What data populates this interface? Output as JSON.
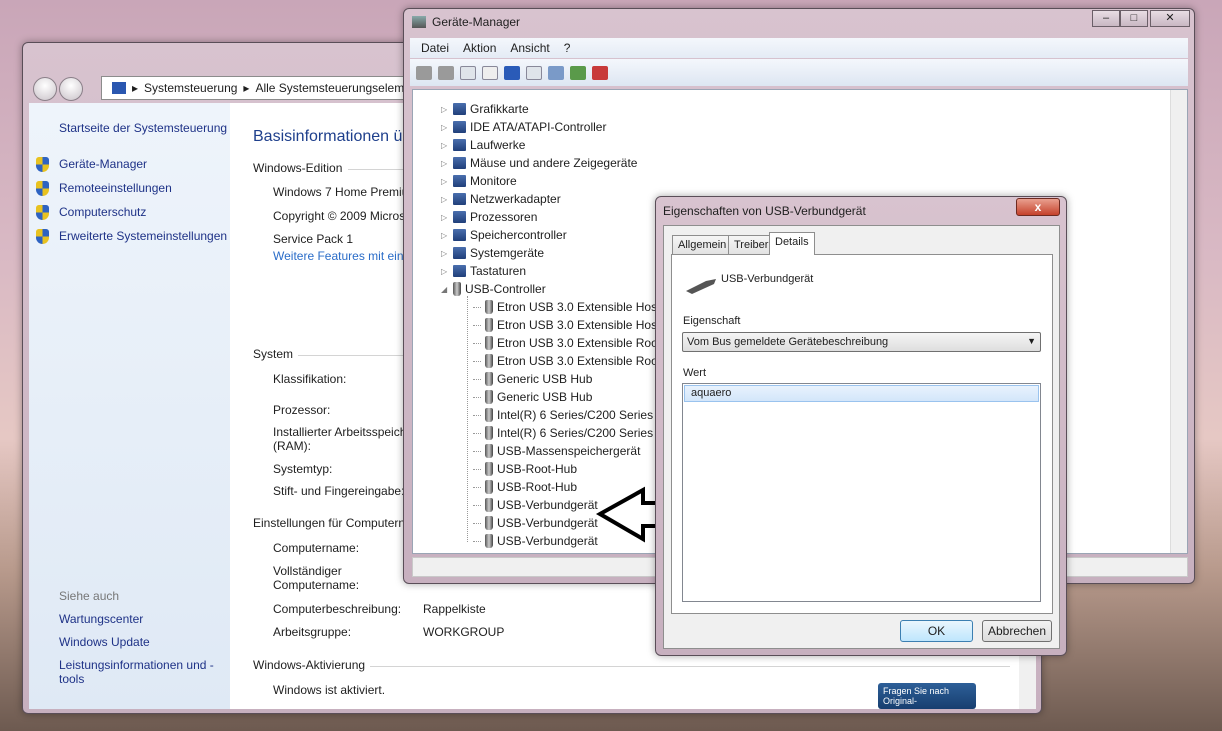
{
  "control_panel": {
    "breadcrumb": [
      "Systemsteuerung",
      "Alle Systemsteuerungseleme"
    ],
    "left": {
      "home": "Startseite der Systemsteuerung",
      "tasks": [
        "Geräte-Manager",
        "Remoteeinstellungen",
        "Computerschutz",
        "Erweiterte Systemeinstellungen"
      ],
      "see_also": "Siehe auch",
      "see_links": [
        "Wartungscenter",
        "Windows Update",
        "Leistungsinformationen und -tools"
      ]
    },
    "title": "Basisinformationen üb",
    "edition": {
      "heading": "Windows-Edition",
      "lines": [
        "Windows 7 Home Premiu",
        "Copyright © 2009 Micros",
        "Service Pack 1"
      ],
      "link": "Weitere Features mit eine"
    },
    "system": {
      "heading": "System",
      "labels": [
        "Klassifikation:",
        "Prozessor:",
        "Installierter Arbeitsspeich (RAM):",
        "Systemtyp:",
        "Stift- und Fingereingabe:"
      ]
    },
    "computer": {
      "heading": "Einstellungen für Computern",
      "labels": [
        "Computername:",
        "Vollständiger Computername:",
        "Computerbeschreibung:",
        "Arbeitsgruppe:"
      ],
      "description": "Rappelkiste",
      "workgroup": "WORKGROUP"
    },
    "activation": {
      "heading": "Windows-Aktivierung",
      "status": "Windows ist aktiviert.",
      "badge": "Fragen Sie nach Original-"
    }
  },
  "device_manager": {
    "title": "Geräte-Manager",
    "menu": [
      "Datei",
      "Aktion",
      "Ansicht",
      "?"
    ],
    "categories": [
      "Grafikkarte",
      "IDE ATA/ATAPI-Controller",
      "Laufwerke",
      "Mäuse und andere Zeigegeräte",
      "Monitore",
      "Netzwerkadapter",
      "Prozessoren",
      "Speichercontroller",
      "Systemgeräte",
      "Tastaturen",
      "USB-Controller"
    ],
    "usb_devices": [
      "Etron USB 3.0 Extensible Host C",
      "Etron USB 3.0 Extensible Host C",
      "Etron USB 3.0 Extensible Root H",
      "Etron USB 3.0 Extensible Root H",
      "Generic USB Hub",
      "Generic USB Hub",
      "Intel(R) 6 Series/C200 Series Ch",
      "Intel(R) 6 Series/C200 Series Ch",
      "USB-Massenspeichergerät",
      "USB-Root-Hub",
      "USB-Root-Hub",
      "USB-Verbundgerät",
      "USB-Verbundgerät",
      "USB-Verbundgerät"
    ]
  },
  "dialog": {
    "title": "Eigenschaften von USB-Verbundgerät",
    "close": "x",
    "tabs": [
      "Allgemein",
      "Treiber",
      "Details"
    ],
    "device_name": "USB-Verbundgerät",
    "property_label": "Eigenschaft",
    "property_value": "Vom Bus gemeldete Gerätebeschreibung",
    "value_label": "Wert",
    "values": [
      "aquaero"
    ],
    "ok": "OK",
    "cancel": "Abbrechen"
  }
}
